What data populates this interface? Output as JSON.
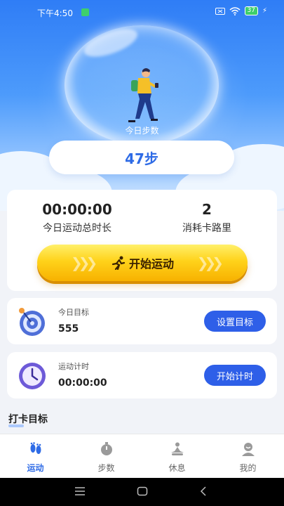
{
  "status_bar": {
    "time": "下午4:50",
    "battery": "37"
  },
  "hero": {
    "steps_label": "今日步数",
    "steps_value": "47步"
  },
  "stats": {
    "duration_value": "00:00:00",
    "duration_label": "今日运动总时长",
    "calories_value": "2",
    "calories_label": "消耗卡路里",
    "start_button": "开始运动"
  },
  "goal_card": {
    "title": "今日目标",
    "value": "555",
    "button": "设置目标"
  },
  "timer_card": {
    "title": "运动计时",
    "value": "00:00:00",
    "button": "开始计时"
  },
  "section_title": "打卡目标",
  "tabs": [
    {
      "label": "运动",
      "active": true,
      "icon": "footprints-icon"
    },
    {
      "label": "步数",
      "active": false,
      "icon": "stopwatch-icon"
    },
    {
      "label": "休息",
      "active": false,
      "icon": "meditation-icon"
    },
    {
      "label": "我的",
      "active": false,
      "icon": "profile-icon"
    }
  ],
  "colors": {
    "accent": "#2e5fe8",
    "hero_blue": "#2f7df6",
    "button_yellow": "#ffd21a"
  }
}
